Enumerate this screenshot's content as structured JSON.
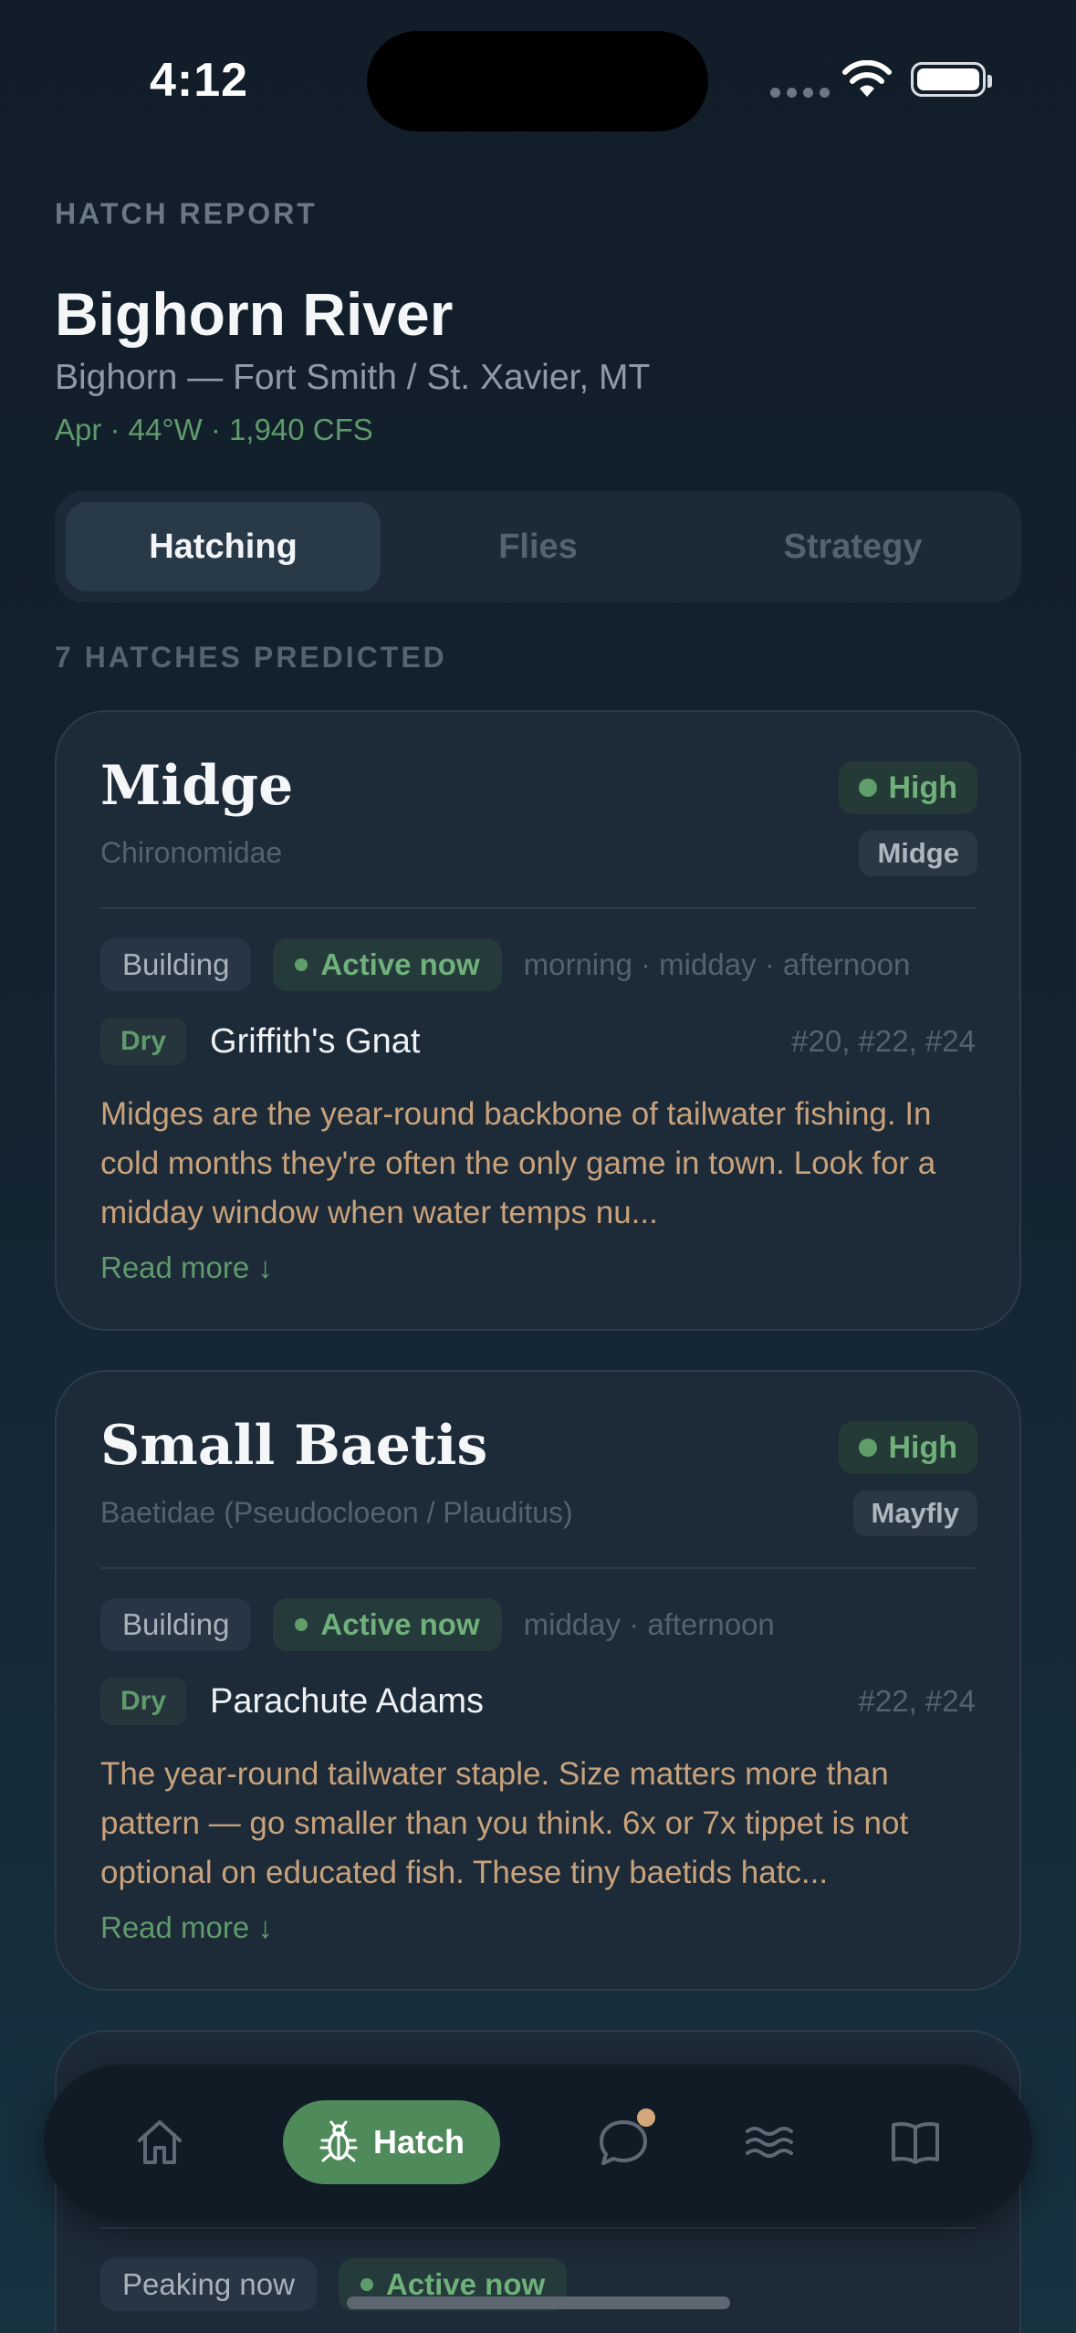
{
  "status_bar": {
    "time": "4:12"
  },
  "header": {
    "eyebrow": "HATCH REPORT",
    "title": "Bighorn River",
    "subtitle": "Bighorn — Fort Smith / St. Xavier, MT",
    "meta": "Apr · 44°W · 1,940 CFS"
  },
  "tabs": [
    {
      "label": "Hatching",
      "active": true
    },
    {
      "label": "Flies",
      "active": false
    },
    {
      "label": "Strategy",
      "active": false
    }
  ],
  "section_label": "7 HATCHES PREDICTED",
  "hatches": [
    {
      "name": "Midge",
      "latin": "Chironomidae",
      "likelihood": "High",
      "type": "Midge",
      "stage": "Building",
      "status": "Active now",
      "times": "morning · midday · afternoon",
      "fly_tag": "Dry",
      "fly_name": "Griffith's Gnat",
      "fly_sizes": "#20, #22, #24",
      "description": "Midges are the year-round backbone of tailwater fishing. In cold months they're often the only game in town. Look for a midday window when water temps nu...",
      "read_more": "Read more ↓"
    },
    {
      "name": "Small Baetis",
      "latin": "Baetidae (Pseudocloeon / Plauditus)",
      "likelihood": "High",
      "type": "Mayfly",
      "stage": "Building",
      "status": "Active now",
      "times": "midday · afternoon",
      "fly_tag": "Dry",
      "fly_name": "Parachute Adams",
      "fly_sizes": "#22, #24",
      "description": "The year-round tailwater staple. Size matters more than pattern — go smaller than you think. 6x or 7x tippet is not optional on educated fish. These tiny baetids hatc...",
      "read_more": "Read more ↓"
    },
    {
      "stage": "Peaking now",
      "status": "Active now"
    }
  ],
  "bottom_nav": {
    "items": [
      {
        "icon": "home-icon"
      },
      {
        "icon": "bug-icon",
        "label": "Hatch",
        "active": true
      },
      {
        "icon": "chat-icon",
        "has_notification": true
      },
      {
        "icon": "water-icon"
      },
      {
        "icon": "book-icon"
      }
    ]
  },
  "colors": {
    "accent_green": "#5f9a6c",
    "description_tan": "#c8a27b",
    "background": "#142330"
  }
}
